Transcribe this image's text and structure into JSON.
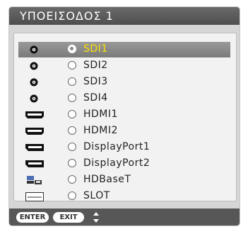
{
  "window": {
    "title": "ΥΠΟΕΙΣΟΔΟΣ 1"
  },
  "inputs": [
    {
      "label": "SDI1",
      "icon": "bnc-icon",
      "selected": true
    },
    {
      "label": "SDI2",
      "icon": "bnc-icon",
      "selected": false
    },
    {
      "label": "SDI3",
      "icon": "bnc-icon",
      "selected": false
    },
    {
      "label": "SDI4",
      "icon": "bnc-icon",
      "selected": false
    },
    {
      "label": "HDMI1",
      "icon": "hdmi-icon",
      "selected": false
    },
    {
      "label": "HDMI2",
      "icon": "hdmi-icon",
      "selected": false
    },
    {
      "label": "DisplayPort1",
      "icon": "displayport-icon",
      "selected": false
    },
    {
      "label": "DisplayPort2",
      "icon": "displayport-icon",
      "selected": false
    },
    {
      "label": "HDBaseT",
      "icon": "network-icon",
      "selected": false
    },
    {
      "label": "SLOT",
      "icon": "slot-icon",
      "selected": false
    }
  ],
  "footer": {
    "enter_label": "ENTER",
    "exit_label": "EXIT",
    "nav_icon": "updown-arrows-icon"
  },
  "colors": {
    "selected_text": "#ffe000",
    "titlebar": "#5a5a5a",
    "footer": "#575757"
  }
}
